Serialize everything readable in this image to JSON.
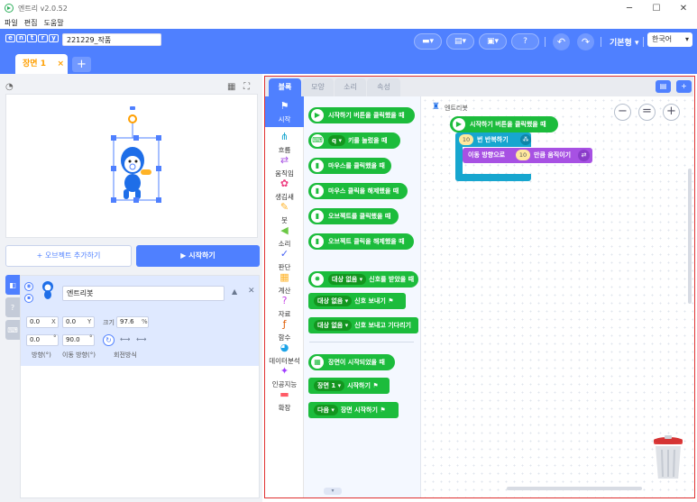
{
  "window": {
    "title": "엔트리 v2.0.52",
    "minimize": "─",
    "maximize": "☐",
    "close": "✕"
  },
  "menu": [
    "파일",
    "편집",
    "도움말"
  ],
  "header": {
    "logo_letters": [
      "e",
      "n",
      "t",
      "r",
      "y"
    ],
    "project_name": "221229_작품",
    "mode_label": "기본형 ▾",
    "language": "한국어",
    "help_label": "?"
  },
  "scene": {
    "tab_label": "장면 1",
    "close": "×",
    "add": "+"
  },
  "stage": {
    "add_object": "+ 오브젝트 추가하기",
    "start": "▶ 시작하기"
  },
  "object": {
    "name": "엔트리봇",
    "x": "0.0",
    "x_unit": "X",
    "y": "0.0",
    "y_unit": "Y",
    "size_label": "크기",
    "size": "97.6",
    "size_unit": "%",
    "direction": "0.0",
    "direction_unit": "°",
    "move_direction": "90.0",
    "move_direction_unit": "°",
    "direction_label": "방향(°)",
    "move_direction_label": "이동 방향(°)",
    "rotation_label": "회전방식"
  },
  "editor": {
    "tabs": [
      "블록",
      "모양",
      "소리",
      "속성"
    ],
    "categories": [
      {
        "label": "시작",
        "icon": "flag-icon",
        "color": "#1cbc3c"
      },
      {
        "label": "흐름",
        "icon": "flow-icon",
        "color": "#17a6cf"
      },
      {
        "label": "움직임",
        "icon": "move-icon",
        "color": "#a751e3"
      },
      {
        "label": "생김새",
        "icon": "looks-icon",
        "color": "#ee3a7f"
      },
      {
        "label": "붓",
        "icon": "brush-icon",
        "color": "#ffb327"
      },
      {
        "label": "소리",
        "icon": "sound-icon",
        "color": "#6cc846"
      },
      {
        "label": "판단",
        "icon": "judge-icon",
        "color": "#4562f5"
      },
      {
        "label": "계산",
        "icon": "calc-icon",
        "color": "#ffb327"
      },
      {
        "label": "자료",
        "icon": "data-icon",
        "color": "#c43ee6"
      },
      {
        "label": "함수",
        "icon": "function-icon",
        "color": "#de5c04"
      },
      {
        "label": "데이터분석",
        "icon": "data-analysis-icon",
        "color": "#1ea4e8"
      },
      {
        "label": "인공지능",
        "icon": "ai-icon",
        "color": "#a03dff"
      },
      {
        "label": "확장",
        "icon": "extension-icon",
        "color": "#ff5b67"
      }
    ],
    "palette": [
      {
        "text": "시작하기 버튼을 클릭했을 때",
        "kind": "start"
      },
      {
        "text": "키를 눌렀을 때",
        "dropdown": "q ▾",
        "kind": "key"
      },
      {
        "text": "마우스를 클릭했을 때",
        "kind": "mouse"
      },
      {
        "text": "마우스 클릭을 해제했을 때",
        "kind": "mouse"
      },
      {
        "text": "오브젝트를 클릭했을 때",
        "kind": "mouse"
      },
      {
        "text": "오브젝트 클릭을 해제했을 때",
        "kind": "mouse"
      },
      {
        "text": "신호를 받았을 때",
        "dropdown": "대상 없음 ▾",
        "kind": "signal"
      },
      {
        "text": "신호 보내기",
        "dropdown": "대상 없음 ▾",
        "kind": "cmd"
      },
      {
        "text": "신호 보내고 기다리기",
        "dropdown": "대상 없음 ▾",
        "kind": "cmd"
      },
      {
        "text": "장면이 시작되었을 때",
        "kind": "scene"
      },
      {
        "text": "시작하기",
        "dropdown": "장면 1 ▾",
        "kind": "cmd"
      },
      {
        "text": "장면 시작하기",
        "dropdown": "다음 ▾",
        "kind": "cmd"
      }
    ],
    "canvas_object_label": "엔트리봇",
    "script": {
      "start": "시작하기 버튼을 클릭했을 때",
      "repeat_count": "10",
      "repeat_text": "번 반복하기",
      "move_prefix": "이동 방향으로",
      "move_count": "10",
      "move_suffix": "만큼 움직이기"
    },
    "zoom": [
      "−",
      "=",
      "+"
    ]
  }
}
